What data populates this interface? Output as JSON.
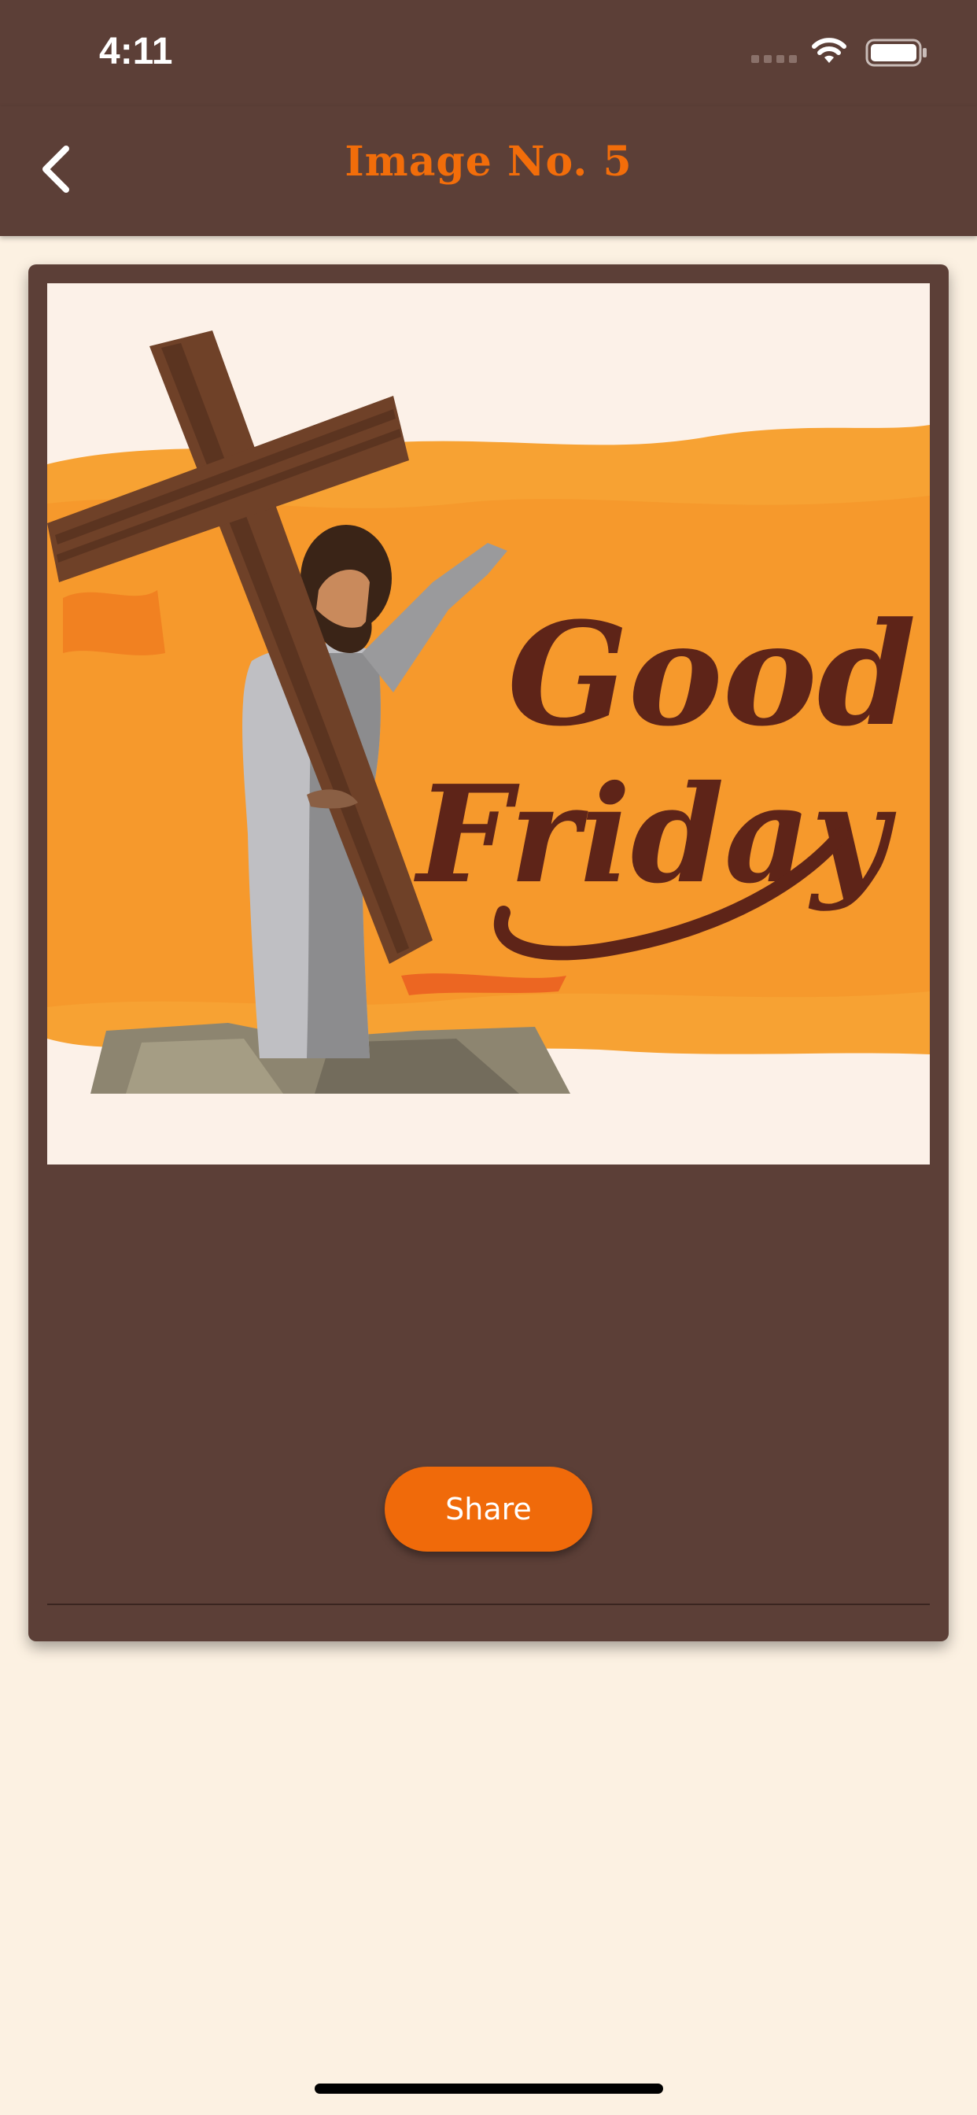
{
  "status_bar": {
    "time": "4:11",
    "icons": [
      "cellular-signal-icon",
      "wifi-icon",
      "battery-icon"
    ]
  },
  "nav": {
    "back_icon": "chevron-left-icon",
    "title": "Image No. 5"
  },
  "image": {
    "lettering": "Good Friday"
  },
  "actions": {
    "share_label": "Share"
  },
  "colors": {
    "bar_background": "#5c3f37",
    "page_background": "#fcf1e2",
    "accent": "#f06a0a",
    "title": "#f26d0a"
  }
}
